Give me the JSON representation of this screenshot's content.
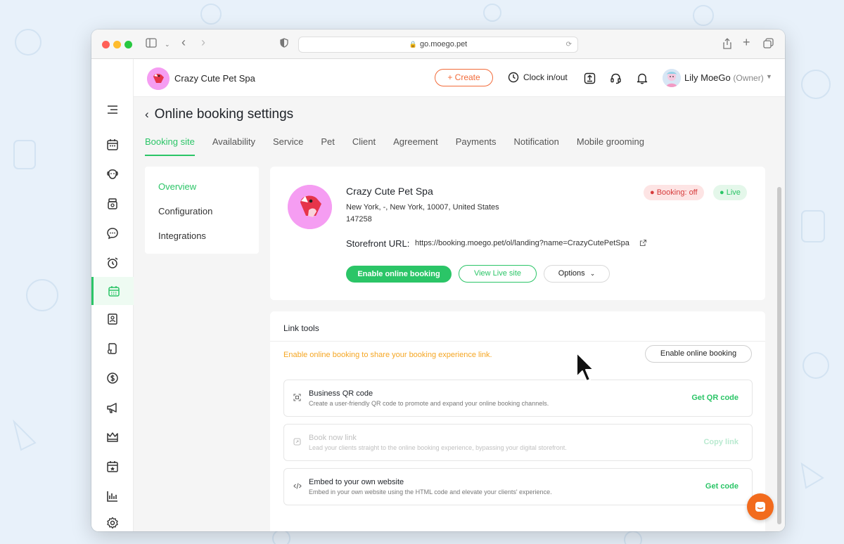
{
  "browser": {
    "url": "go.moego.pet"
  },
  "topbar": {
    "business_name": "Crazy Cute Pet Spa",
    "create_label": "+ Create",
    "clock_label": "Clock in/out",
    "user_name": "Lily MoeGo",
    "user_role": "(Owner)"
  },
  "leftnav": {
    "items": [
      "menu",
      "calendar",
      "pets",
      "inventory",
      "messages",
      "reminders",
      "online-booking",
      "client-card",
      "documents",
      "payments",
      "marketing",
      "crown",
      "schedule",
      "reports",
      "settings"
    ],
    "active": "online-booking"
  },
  "page": {
    "title": "Online booking settings",
    "tabs": [
      {
        "label": "Booking site",
        "active": true
      },
      {
        "label": "Availability",
        "active": false
      },
      {
        "label": "Service",
        "active": false
      },
      {
        "label": "Pet",
        "active": false
      },
      {
        "label": "Client",
        "active": false
      },
      {
        "label": "Agreement",
        "active": false
      },
      {
        "label": "Payments",
        "active": false
      },
      {
        "label": "Notification",
        "active": false
      },
      {
        "label": "Mobile grooming",
        "active": false
      }
    ]
  },
  "subnav": {
    "items": [
      "Overview",
      "Configuration",
      "Integrations"
    ],
    "active": "Overview"
  },
  "overview": {
    "name": "Crazy Cute Pet Spa",
    "address": "New York, -, New York, 10007, United States",
    "phone": "147258",
    "badge_booking": "● Booking: off",
    "badge_live": "● Live",
    "storefront_label": "Storefront URL:",
    "storefront_url": "https://booking.moego.pet/ol/landing?name=CrazyCutePetSpa",
    "btn_enable": "Enable online booking",
    "btn_view_live": "View Live site",
    "btn_options": "Options"
  },
  "link_tools": {
    "title": "Link tools",
    "warning": "Enable online booking to share your booking experience link.",
    "enable_button": "Enable online booking",
    "tools": [
      {
        "title": "Business QR code",
        "desc": "Create a user-friendly QR code to promote and expand your online booking channels.",
        "action": "Get QR code",
        "disabled": false
      },
      {
        "title": "Book now link",
        "desc": "Lead your clients straight to the online booking experience, bypassing your digital storefront.",
        "action": "Copy link",
        "disabled": true
      },
      {
        "title": "Embed to your own website",
        "desc": "Embed in your own website using the HTML code and elevate your clients' experience.",
        "action": "Get code",
        "disabled": false
      }
    ]
  },
  "colors": {
    "accent": "#2bc567",
    "create": "#f26b3a",
    "warning": "#f5a623",
    "badge_off": "#d63b3b"
  }
}
